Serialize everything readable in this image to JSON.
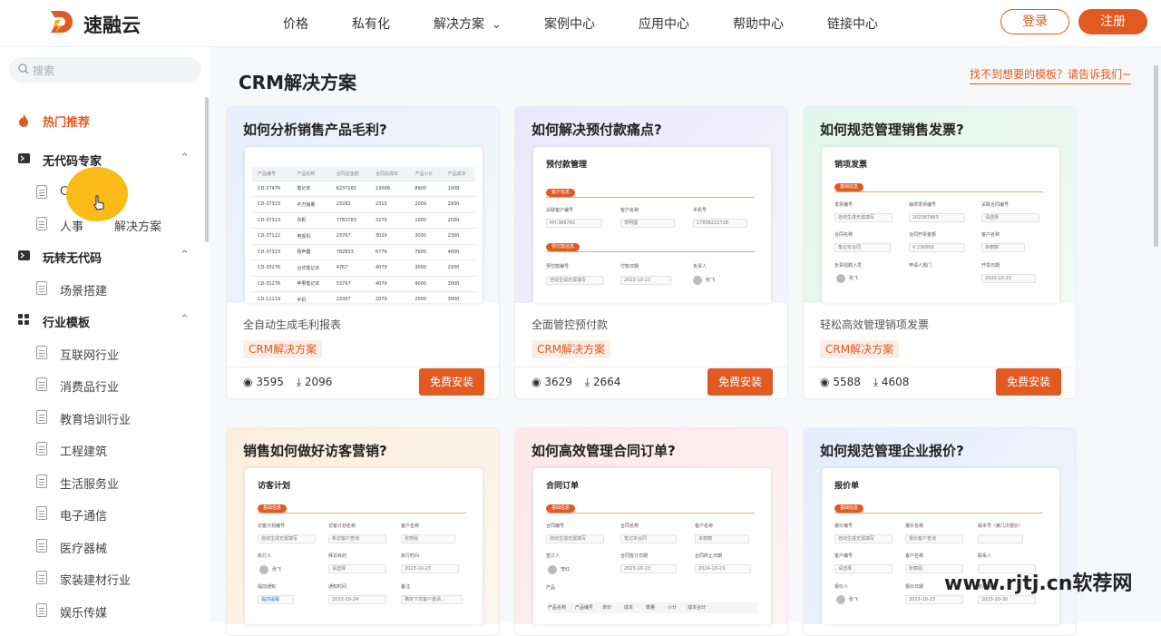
{
  "header": {
    "brand": "速融云",
    "nav": [
      "价格",
      "私有化",
      "解决方案",
      "案例中心",
      "应用中心",
      "帮助中心",
      "链接中心"
    ],
    "login": "登录",
    "register": "注册"
  },
  "sidebar": {
    "search_placeholder": "搜索",
    "hot": "热门推荐",
    "sections": [
      {
        "label": "无代码专家",
        "items": [
          "CRM解决方案",
          "人事行政解决方案"
        ]
      },
      {
        "label": "玩转无代码",
        "items": [
          "场景搭建"
        ]
      },
      {
        "label": "行业模板",
        "items": [
          "互联网行业",
          "消费品行业",
          "教育培训行业",
          "工程建筑",
          "生活服务业",
          "电子通信",
          "医疗器械",
          "家装建材行业",
          "娱乐传媒"
        ]
      }
    ],
    "visible_item_fragment": "C",
    "visible_item_fragment_2a": "人事",
    "visible_item_fragment_2b": "解决方案"
  },
  "main": {
    "title": "CRM解决方案",
    "request_link": "找不到想要的模板？请告诉我们~",
    "cards": [
      {
        "title": "如何分析销售产品毛利?",
        "desc": "全自动生成毛利报表",
        "tag": "CRM解决方案",
        "views": "3595",
        "downloads": "2096",
        "install": "免费安装"
      },
      {
        "title": "如何解决预付款痛点?",
        "desc": "全面管控预付款",
        "tag": "CRM解决方案",
        "views": "3629",
        "downloads": "2664",
        "install": "免费安装"
      },
      {
        "title": "如何规范管理销售发票?",
        "desc": "轻松高效管理销项发票",
        "tag": "CRM解决方案",
        "views": "5588",
        "downloads": "4608",
        "install": "免费安装"
      },
      {
        "title": "销售如何做好访客营销?"
      },
      {
        "title": "如何高效管理合同订单?"
      },
      {
        "title": "如何规范管理企业报价?"
      }
    ],
    "shots": {
      "table": {
        "headers": [
          "产品编号",
          "产品名称",
          "合同总金额",
          "合同总成本",
          "产品小计",
          "产品成本"
        ],
        "rows": [
          [
            "CD-37476",
            "笔记本",
            "6237282",
            "13008",
            "8900",
            "1008"
          ],
          [
            "CD-37323",
            "平方销量",
            "23282",
            "2310",
            "2009",
            "2930"
          ],
          [
            "CD-37323",
            "衣柜",
            "7783783",
            "3270",
            "1000",
            "2030"
          ],
          [
            "CD-37122",
            "电视机",
            "23767",
            "3029",
            "3000",
            "2300"
          ],
          [
            "CD-37323",
            "扬声器",
            "782833",
            "6779",
            "7900",
            "4600"
          ],
          [
            "CD-33276",
            "台式笔记本",
            "4767",
            "4079",
            "3000",
            "2930"
          ],
          [
            "CD-31276",
            "苹果笔记本",
            "53767",
            "4079",
            "9000",
            "3000"
          ],
          [
            "CD-11119",
            "手机",
            "23367",
            "2079",
            "2000",
            "3000"
          ]
        ]
      },
      "prepay": {
        "title": "预付款管理",
        "sec1": "客户信息",
        "sec2": "预付款信息",
        "l1": "关联客户编号",
        "v1": "KH-386783",
        "l2": "客户名称",
        "v2": "李明理",
        "l3": "手机号",
        "v3": "17836222728",
        "l4": "预付款编号",
        "v4": "自动生成无需填写",
        "l5": "付款日期",
        "v5": "2023-10-23",
        "l6": "负责人",
        "v6": "张飞"
      },
      "invoice": {
        "title": "销项发票",
        "sec1": "基础信息",
        "l1": "发票编号",
        "v1": "自动生成无需填写",
        "l2": "销项发票编号",
        "v2": "202387863",
        "l3": "关联合同编号",
        "v3": "请选择",
        "l4": "合同名称",
        "v4": "笔记本合同",
        "l5": "合同开票金额",
        "v5": "¥ 230000",
        "l6": "客户名称",
        "v6": "多丽丽",
        "l7": "负责招聘人员",
        "v7": "张飞",
        "l8": "申请人部门",
        "l9": "开票日期",
        "v9": "2023-10-23"
      },
      "visit": {
        "title": "访客计划",
        "sec1": "基础信息",
        "l1": "访客计划编号",
        "v1": "自动生成无需填写",
        "l2": "访客计划名称",
        "v2": "新访客户查询",
        "l3": "客户名称",
        "v3": "张丽强",
        "l4": "执行人",
        "v4": "张飞",
        "l5": "拜访目的",
        "v5": "请选择",
        "l6": "执行时间",
        "v6": "2023-10-23",
        "l7": "提前通知",
        "v7": "提前提醒",
        "l8": "通知时间",
        "v8": "2023-10-24",
        "l9": "备注",
        "v9": "确定下次客户邀请..."
      },
      "contract": {
        "title": "合同订单",
        "sec1": "基础信息",
        "l1": "合同编号",
        "v1": "自动生成无需填写",
        "l2": "合同名称",
        "v2": "笔记本合同",
        "l3": "客户名称",
        "v3": "多丽丽",
        "l4": "签订人",
        "v4": "李红",
        "l5": "合同签订日期",
        "v5": "2023-10-23",
        "l6": "合同终止日期",
        "v6": "2024-10-23",
        "l7": "产品",
        "cols": [
          "产品名称",
          "产品编号",
          "单价",
          "成本",
          "数量",
          "小计",
          "成本合计"
        ]
      },
      "quote": {
        "title": "报价单",
        "sec1": "基础信息",
        "l1": "报价编号",
        "v1": "自动生成无需填写",
        "l2": "报价名称",
        "v2": "报价客户查询",
        "l3": "版本号（第几次报价）",
        "l4": "客户编号",
        "v4": "请选择",
        "l5": "客户名称",
        "v5": "张丽强",
        "l6": "联系人",
        "l7": "报价人",
        "v7": "张飞",
        "l8": "报价日期",
        "v8": "2023-10-23",
        "l9": "有效期至",
        "v9": "2023-10-30"
      }
    }
  },
  "watermark": "www.rjtj.cn软荐网",
  "colors": {
    "accent": "#e05a21"
  }
}
